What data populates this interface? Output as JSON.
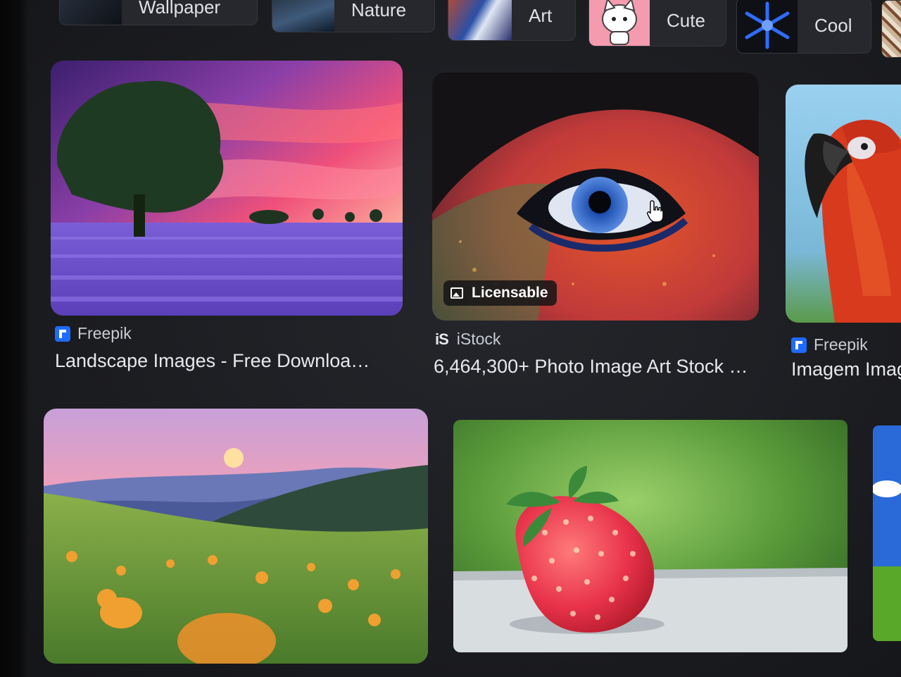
{
  "filter_chips": [
    {
      "label": "Wallpaper"
    },
    {
      "label": "Nature"
    },
    {
      "label": "Art"
    },
    {
      "label": "Cute"
    },
    {
      "label": "Cool"
    }
  ],
  "results": [
    {
      "source": "Freepik",
      "title": "Landscape Images - Free Downloa…",
      "badge": ""
    },
    {
      "source": "iStock",
      "source_mark": "iS",
      "title": "6,464,300+ Photo Image Art Stock …",
      "badge": "Licensable"
    },
    {
      "source": "Freepik",
      "title": "Imagem Imag",
      "badge": ""
    }
  ],
  "icons": {
    "freepik_favicon": "freepik-icon",
    "licensable_badge_icon": "image-icon",
    "cursor": "hand-pointer-icon"
  },
  "colors": {
    "background": "#1c1d21",
    "freepik_blue": "#1e6bff",
    "text_primary": "#e6e8ec",
    "text_secondary": "#c9ccd2"
  }
}
